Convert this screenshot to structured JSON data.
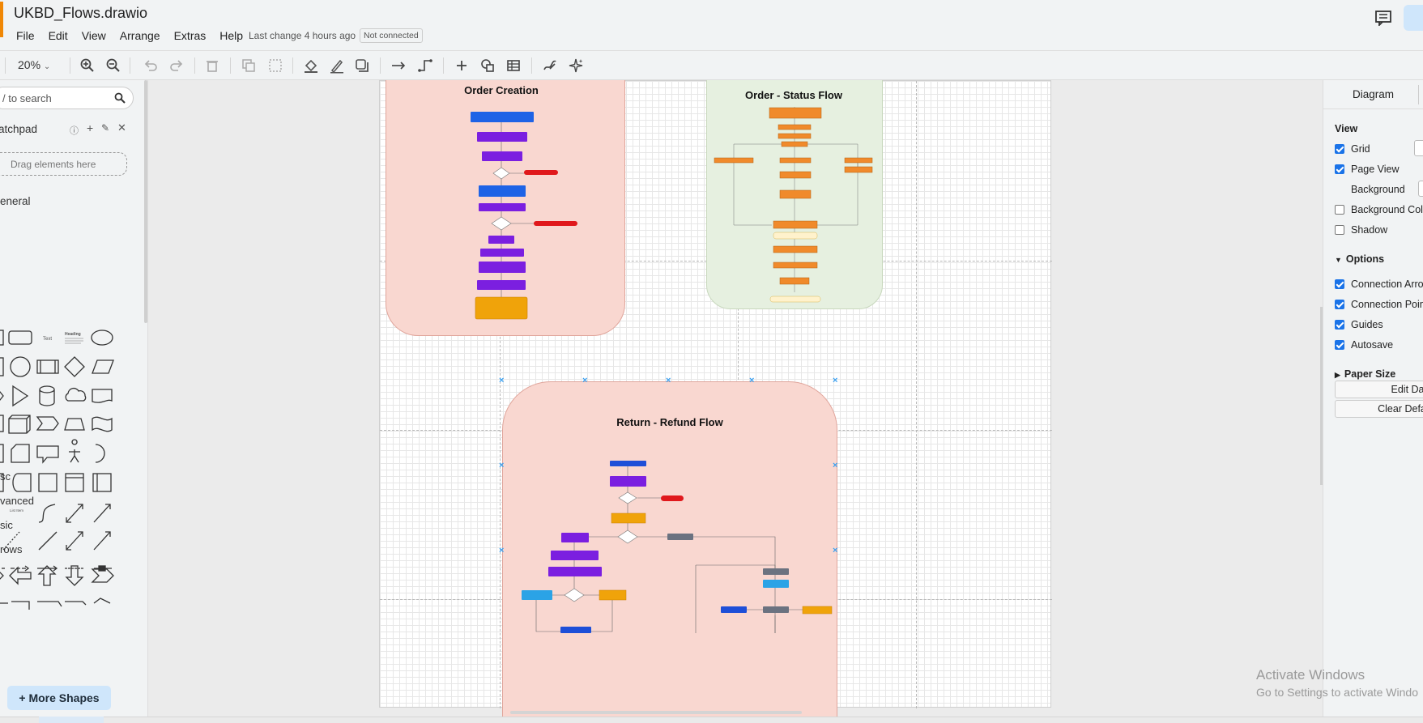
{
  "app": {
    "file_title": "UKBD_Flows.drawio",
    "menu": [
      "File",
      "Edit",
      "View",
      "Arrange",
      "Extras",
      "Help"
    ],
    "last_change": "Last change 4 hours ago",
    "connection_status": "Not connected",
    "icons": {
      "comments": "comments-icon",
      "share": "share-icon"
    }
  },
  "toolbar": {
    "zoom": "20%",
    "icons": [
      "zoom-in-icon",
      "zoom-out-icon",
      "undo-icon",
      "redo-icon",
      "delete-icon",
      "to-front-icon",
      "to-back-icon",
      "fill-color-icon",
      "line-color-icon",
      "shadow-icon",
      "connection-icon",
      "waypoints-icon",
      "insert-icon",
      "shapes-icon",
      "table-icon",
      "freehand-icon",
      "ai-generate-icon"
    ]
  },
  "sidebar": {
    "search_placeholder": "/ to search",
    "scratchpad_title": "atchpad",
    "scratchpad_drop": "Drag elements here",
    "general_title": "eneral",
    "palette_text_label": "Text",
    "palette_heading_label": "Heading",
    "palette_list_label": "List Item",
    "categories": [
      "sc",
      "vanced",
      "sic",
      "rows"
    ],
    "more_shapes": "+ More Shapes"
  },
  "canvas": {
    "containers": [
      {
        "title": "Order Creation",
        "color": "#f9d7d0"
      },
      {
        "title": "Order - Status Flow",
        "color": "#e6f0e0"
      },
      {
        "title": "Return - Refund Flow",
        "color": "#f9d7d0"
      }
    ]
  },
  "right_panel": {
    "tab": "Diagram",
    "view_title": "View",
    "view_options": [
      {
        "label": "Grid",
        "checked": true
      },
      {
        "label": "Page View",
        "checked": true
      },
      {
        "label": "Background",
        "checked": null
      },
      {
        "label": "Background Colo",
        "checked": false
      },
      {
        "label": "Shadow",
        "checked": false
      }
    ],
    "options_title": "Options",
    "options": [
      {
        "label": "Connection Arrow",
        "checked": true
      },
      {
        "label": "Connection Point",
        "checked": true
      },
      {
        "label": "Guides",
        "checked": true
      },
      {
        "label": "Autosave",
        "checked": true
      }
    ],
    "paper_size": "Paper Size",
    "edit_data": "Edit Da",
    "clear_default": "Clear Defa"
  },
  "watermark": {
    "line1": "Activate Windows",
    "line2": "Go to Settings to activate Windo"
  }
}
